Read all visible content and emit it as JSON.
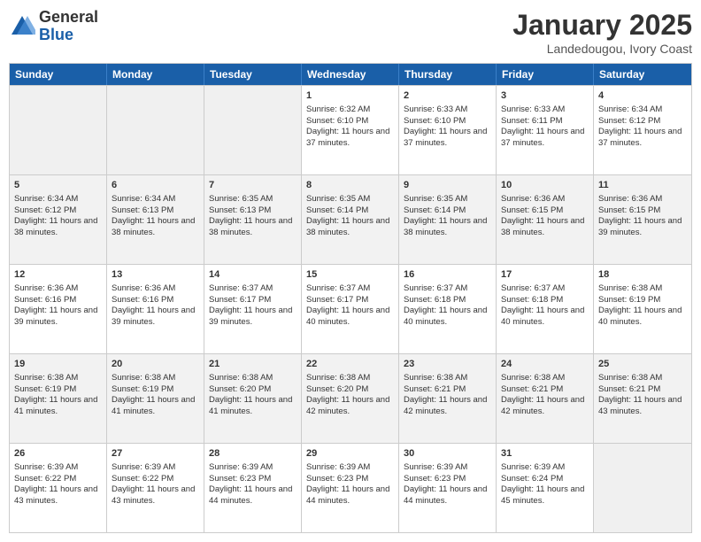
{
  "logo": {
    "general": "General",
    "blue": "Blue"
  },
  "header": {
    "title": "January 2025",
    "location": "Landedougou, Ivory Coast"
  },
  "days": [
    "Sunday",
    "Monday",
    "Tuesday",
    "Wednesday",
    "Thursday",
    "Friday",
    "Saturday"
  ],
  "weeks": [
    [
      {
        "day": "",
        "empty": true
      },
      {
        "day": "",
        "empty": true
      },
      {
        "day": "",
        "empty": true
      },
      {
        "day": "1",
        "sunrise": "6:32 AM",
        "sunset": "6:10 PM",
        "daylight": "11 hours and 37 minutes."
      },
      {
        "day": "2",
        "sunrise": "6:33 AM",
        "sunset": "6:10 PM",
        "daylight": "11 hours and 37 minutes."
      },
      {
        "day": "3",
        "sunrise": "6:33 AM",
        "sunset": "6:11 PM",
        "daylight": "11 hours and 37 minutes."
      },
      {
        "day": "4",
        "sunrise": "6:34 AM",
        "sunset": "6:12 PM",
        "daylight": "11 hours and 37 minutes."
      }
    ],
    [
      {
        "day": "5",
        "sunrise": "6:34 AM",
        "sunset": "6:12 PM",
        "daylight": "11 hours and 38 minutes."
      },
      {
        "day": "6",
        "sunrise": "6:34 AM",
        "sunset": "6:13 PM",
        "daylight": "11 hours and 38 minutes."
      },
      {
        "day": "7",
        "sunrise": "6:35 AM",
        "sunset": "6:13 PM",
        "daylight": "11 hours and 38 minutes."
      },
      {
        "day": "8",
        "sunrise": "6:35 AM",
        "sunset": "6:14 PM",
        "daylight": "11 hours and 38 minutes."
      },
      {
        "day": "9",
        "sunrise": "6:35 AM",
        "sunset": "6:14 PM",
        "daylight": "11 hours and 38 minutes."
      },
      {
        "day": "10",
        "sunrise": "6:36 AM",
        "sunset": "6:15 PM",
        "daylight": "11 hours and 38 minutes."
      },
      {
        "day": "11",
        "sunrise": "6:36 AM",
        "sunset": "6:15 PM",
        "daylight": "11 hours and 39 minutes."
      }
    ],
    [
      {
        "day": "12",
        "sunrise": "6:36 AM",
        "sunset": "6:16 PM",
        "daylight": "11 hours and 39 minutes."
      },
      {
        "day": "13",
        "sunrise": "6:36 AM",
        "sunset": "6:16 PM",
        "daylight": "11 hours and 39 minutes."
      },
      {
        "day": "14",
        "sunrise": "6:37 AM",
        "sunset": "6:17 PM",
        "daylight": "11 hours and 39 minutes."
      },
      {
        "day": "15",
        "sunrise": "6:37 AM",
        "sunset": "6:17 PM",
        "daylight": "11 hours and 40 minutes."
      },
      {
        "day": "16",
        "sunrise": "6:37 AM",
        "sunset": "6:18 PM",
        "daylight": "11 hours and 40 minutes."
      },
      {
        "day": "17",
        "sunrise": "6:37 AM",
        "sunset": "6:18 PM",
        "daylight": "11 hours and 40 minutes."
      },
      {
        "day": "18",
        "sunrise": "6:38 AM",
        "sunset": "6:19 PM",
        "daylight": "11 hours and 40 minutes."
      }
    ],
    [
      {
        "day": "19",
        "sunrise": "6:38 AM",
        "sunset": "6:19 PM",
        "daylight": "11 hours and 41 minutes."
      },
      {
        "day": "20",
        "sunrise": "6:38 AM",
        "sunset": "6:19 PM",
        "daylight": "11 hours and 41 minutes."
      },
      {
        "day": "21",
        "sunrise": "6:38 AM",
        "sunset": "6:20 PM",
        "daylight": "11 hours and 41 minutes."
      },
      {
        "day": "22",
        "sunrise": "6:38 AM",
        "sunset": "6:20 PM",
        "daylight": "11 hours and 42 minutes."
      },
      {
        "day": "23",
        "sunrise": "6:38 AM",
        "sunset": "6:21 PM",
        "daylight": "11 hours and 42 minutes."
      },
      {
        "day": "24",
        "sunrise": "6:38 AM",
        "sunset": "6:21 PM",
        "daylight": "11 hours and 42 minutes."
      },
      {
        "day": "25",
        "sunrise": "6:38 AM",
        "sunset": "6:21 PM",
        "daylight": "11 hours and 43 minutes."
      }
    ],
    [
      {
        "day": "26",
        "sunrise": "6:39 AM",
        "sunset": "6:22 PM",
        "daylight": "11 hours and 43 minutes."
      },
      {
        "day": "27",
        "sunrise": "6:39 AM",
        "sunset": "6:22 PM",
        "daylight": "11 hours and 43 minutes."
      },
      {
        "day": "28",
        "sunrise": "6:39 AM",
        "sunset": "6:23 PM",
        "daylight": "11 hours and 44 minutes."
      },
      {
        "day": "29",
        "sunrise": "6:39 AM",
        "sunset": "6:23 PM",
        "daylight": "11 hours and 44 minutes."
      },
      {
        "day": "30",
        "sunrise": "6:39 AM",
        "sunset": "6:23 PM",
        "daylight": "11 hours and 44 minutes."
      },
      {
        "day": "31",
        "sunrise": "6:39 AM",
        "sunset": "6:24 PM",
        "daylight": "11 hours and 45 minutes."
      },
      {
        "day": "",
        "empty": true
      }
    ]
  ]
}
